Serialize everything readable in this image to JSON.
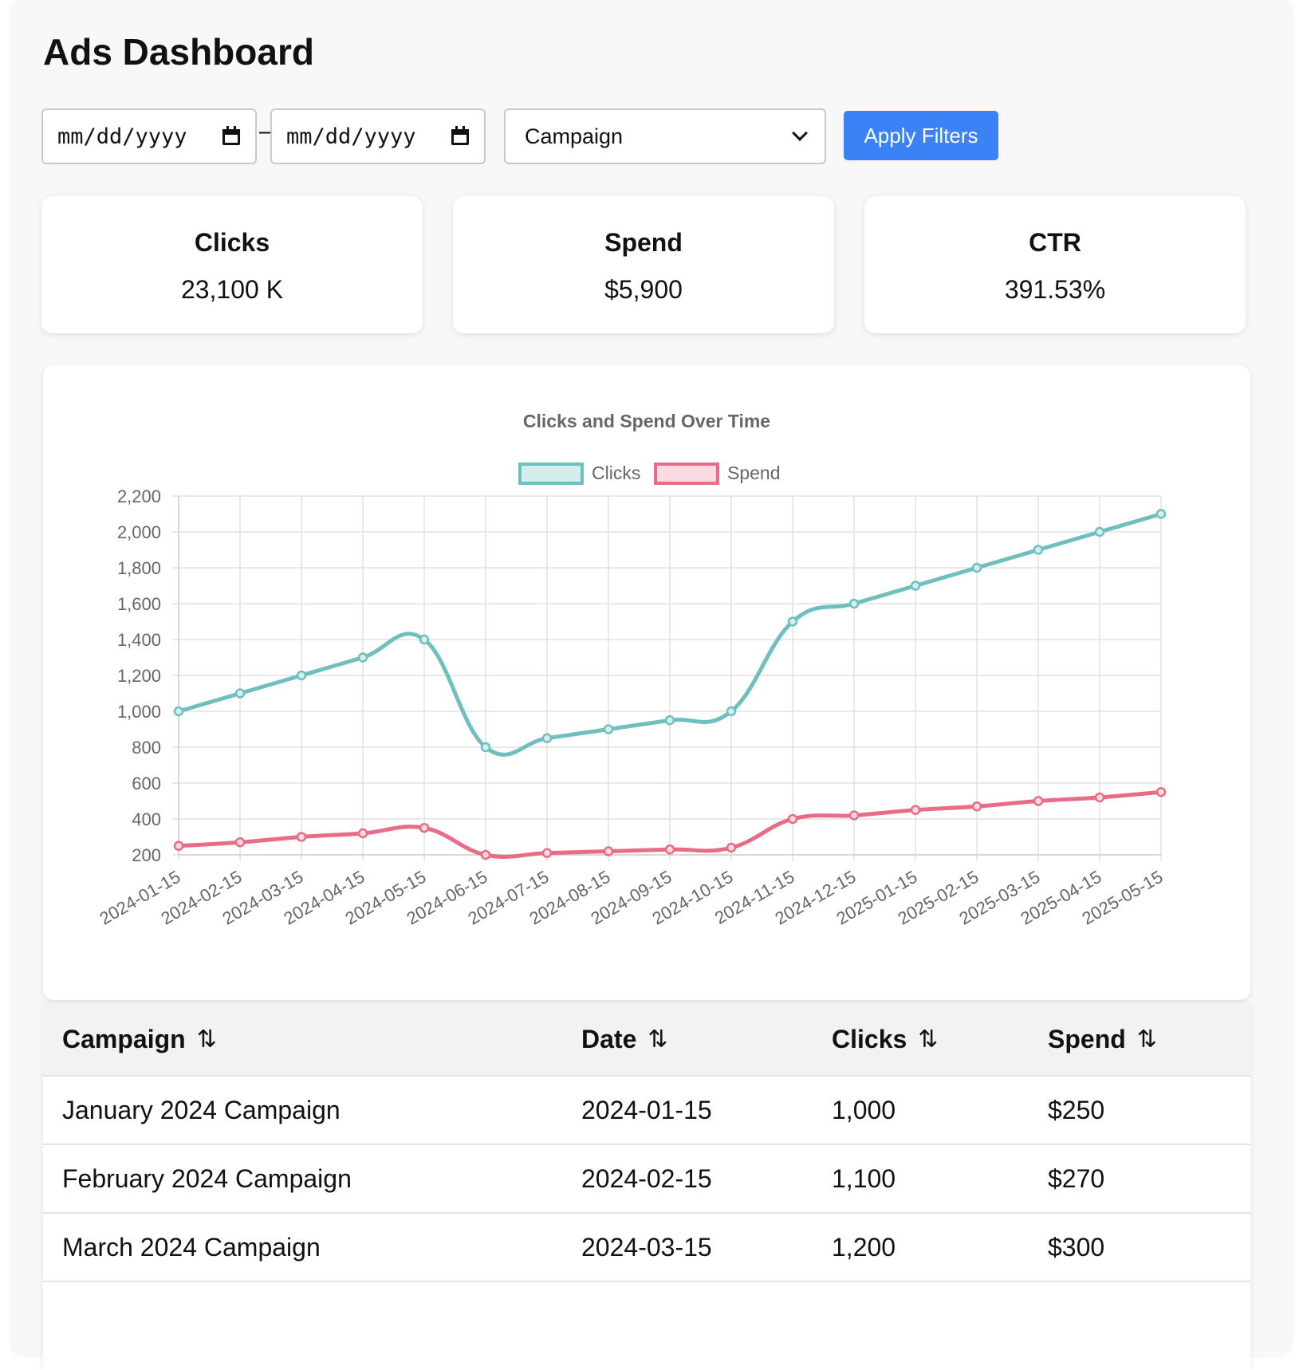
{
  "page": {
    "title": "Ads Dashboard"
  },
  "filters": {
    "start_date": "mm/dd/yyyy",
    "end_date": "mm/dd/yyyy",
    "separator": "–",
    "campaign_select": "Campaign",
    "apply_label": "Apply Filters"
  },
  "kpis": [
    {
      "label": "Clicks",
      "value": "23,100 K"
    },
    {
      "label": "Spend",
      "value": "$5,900"
    },
    {
      "label": "CTR",
      "value": "391.53%"
    }
  ],
  "colors": {
    "clicks": "#6fbfbf",
    "spend": "#e96b86",
    "accent": "#3b82f6"
  },
  "chart_data": {
    "type": "line",
    "title": "Clicks and Spend Over Time",
    "x": [
      "2024-01-15",
      "2024-02-15",
      "2024-03-15",
      "2024-04-15",
      "2024-05-15",
      "2024-06-15",
      "2024-07-15",
      "2024-08-15",
      "2024-09-15",
      "2024-10-15",
      "2024-11-15",
      "2024-12-15",
      "2025-01-15",
      "2025-02-15",
      "2025-03-15",
      "2025-04-15",
      "2025-05-15"
    ],
    "series": [
      {
        "name": "Clicks",
        "values": [
          1000,
          1100,
          1200,
          1300,
          1400,
          800,
          850,
          900,
          950,
          1000,
          1500,
          1600,
          1700,
          1800,
          1900,
          2000,
          2100
        ]
      },
      {
        "name": "Spend",
        "values": [
          250,
          270,
          300,
          320,
          350,
          200,
          210,
          220,
          230,
          240,
          400,
          420,
          450,
          470,
          500,
          520,
          550
        ]
      }
    ],
    "ylim": [
      200,
      2200
    ],
    "yticks": [
      200,
      400,
      600,
      800,
      1000,
      1200,
      1400,
      1600,
      1800,
      2000,
      2200
    ],
    "ytick_labels": [
      "200",
      "400",
      "600",
      "800",
      "1,000",
      "1,200",
      "1,400",
      "1,600",
      "1,800",
      "2,000",
      "2,200"
    ],
    "grid": true,
    "legend": "top-center"
  },
  "table": {
    "sort_icon": "⇅",
    "columns": [
      "Campaign",
      "Date",
      "Clicks",
      "Spend"
    ],
    "rows": [
      [
        "January 2024 Campaign",
        "2024-01-15",
        "1,000",
        "$250"
      ],
      [
        "February 2024 Campaign",
        "2024-02-15",
        "1,100",
        "$270"
      ],
      [
        "March 2024 Campaign",
        "2024-03-15",
        "1,200",
        "$300"
      ]
    ]
  }
}
